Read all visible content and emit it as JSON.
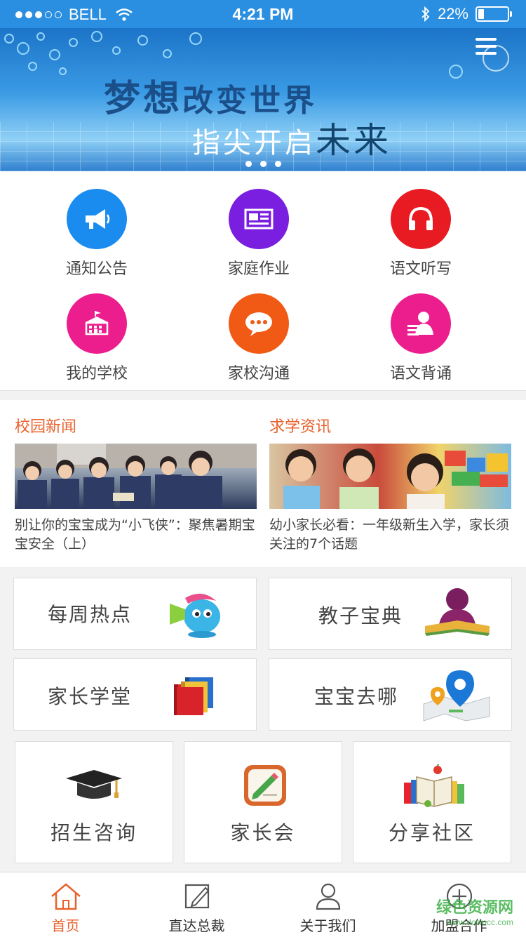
{
  "status_bar": {
    "carrier": "BELL",
    "time": "4:21 PM",
    "battery": "22%",
    "battery_level": 0.22,
    "signal_bars": 3,
    "signal_max": 5
  },
  "banner": {
    "line1_big": "梦想",
    "line1_rest": "改变世界",
    "line2_rest": "指尖开启",
    "line2_big": "未来",
    "pages": 3,
    "active_page": 1
  },
  "quick_menu": [
    {
      "label": "通知公告",
      "icon": "megaphone-icon",
      "color": "#1a8cf0"
    },
    {
      "label": "家庭作业",
      "icon": "newspaper-icon",
      "color": "#7a1ee0"
    },
    {
      "label": "语文听写",
      "icon": "headphones-icon",
      "color": "#e81b23"
    },
    {
      "label": "我的学校",
      "icon": "school-icon",
      "color": "#ec1e8e"
    },
    {
      "label": "家校沟通",
      "icon": "chat-bubble-icon",
      "color": "#f05a14"
    },
    {
      "label": "语文背诵",
      "icon": "recite-icon",
      "color": "#ec1e8e"
    }
  ],
  "news": [
    {
      "section": "校园新闻",
      "text": "别让你的宝宝成为“小飞侠”：聚焦暑期宝宝安全（上）"
    },
    {
      "section": "求学资讯",
      "text": "幼小家长必看：一年级新生入学，家长须关注的7个话题"
    }
  ],
  "features": [
    {
      "label": "每周热点",
      "icon": "megaphone-mascot-icon"
    },
    {
      "label": "教子宝典",
      "icon": "reading-person-icon"
    },
    {
      "label": "家长学堂",
      "icon": "books-icon"
    },
    {
      "label": "宝宝去哪",
      "icon": "map-pin-icon"
    }
  ],
  "tiles": [
    {
      "label": "招生咨询",
      "icon": "graduation-cap-icon"
    },
    {
      "label": "家长会",
      "icon": "pencil-note-icon"
    },
    {
      "label": "分享社区",
      "icon": "open-book-icon"
    }
  ],
  "tabs": [
    {
      "label": "首页",
      "icon": "home-icon",
      "active": true
    },
    {
      "label": "直达总裁",
      "icon": "edit-icon",
      "active": false
    },
    {
      "label": "关于我们",
      "icon": "user-icon",
      "active": false
    },
    {
      "label": "加盟合作",
      "icon": "plus-circle-icon",
      "active": false
    }
  ],
  "watermark": {
    "text": "绿色资源网",
    "sub": "www.downcc.com"
  },
  "colors": {
    "accent": "#e8612c",
    "status_bar": "#2a8fe0"
  }
}
